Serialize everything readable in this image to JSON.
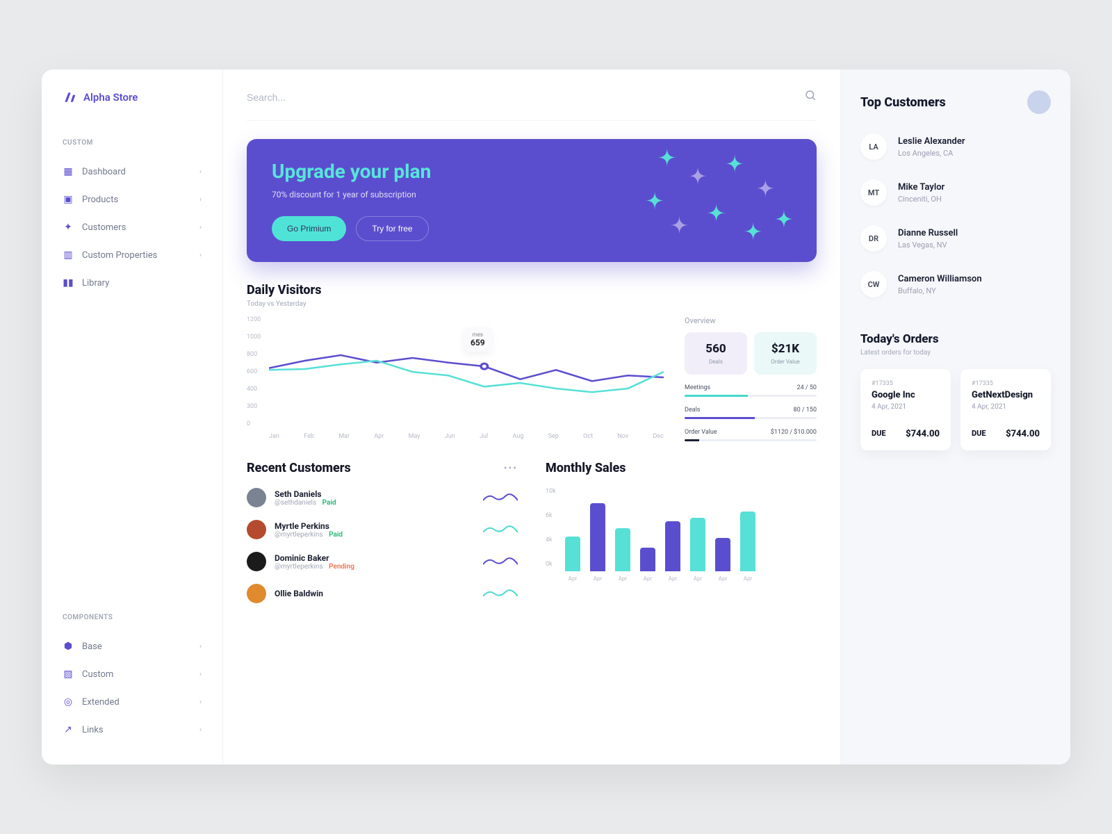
{
  "app": {
    "name": "Alpha Store"
  },
  "search": {
    "placeholder": "Search..."
  },
  "nav": {
    "custom_heading": "CUSTOM",
    "components_heading": "COMPONENTS",
    "custom": [
      {
        "label": "Dashboard",
        "chev": true
      },
      {
        "label": "Products",
        "chev": true
      },
      {
        "label": "Customers",
        "chev": true
      },
      {
        "label": "Custom Properties",
        "chev": true
      },
      {
        "label": "Library",
        "chev": false
      }
    ],
    "components": [
      {
        "label": "Base"
      },
      {
        "label": "Custom"
      },
      {
        "label": "Extended"
      },
      {
        "label": "Links"
      }
    ]
  },
  "hero": {
    "title": "Upgrade your plan",
    "subtitle": "70% discount for 1 year of subscription",
    "primary": "Go Primium",
    "secondary": "Try for free"
  },
  "visitors": {
    "title": "Daily Visitors",
    "subtitle": "Today vs Yesterday",
    "tooltip_label": "mes",
    "tooltip_value": "659",
    "overview_label": "Overview",
    "stats": [
      {
        "value": "560",
        "label": "Deals"
      },
      {
        "value": "$21K",
        "label": "Order Value"
      }
    ],
    "progress": [
      {
        "label": "Meetings",
        "value": "24 / 50",
        "pct": 48,
        "color": "#45d8cd"
      },
      {
        "label": "Deals",
        "value": "80 / 150",
        "pct": 53,
        "color": "#5b4ece"
      },
      {
        "label": "Order Value",
        "value": "$1120 / $10.000",
        "pct": 11,
        "color": "#1c2134"
      }
    ]
  },
  "recent": {
    "title": "Recent Customers",
    "rows": [
      {
        "name": "Seth Daniels",
        "handle": "@sethdaniels",
        "status": "Paid",
        "color": "#5b4ece",
        "avatar": "#7a8391"
      },
      {
        "name": "Myrtle Perkins",
        "handle": "@myrtleperkins",
        "status": "Paid",
        "color": "#4fd9cf",
        "avatar": "#b54b2e"
      },
      {
        "name": "Dominic Baker",
        "handle": "@myrtleperkins",
        "status": "Pending",
        "color": "#5b4ece",
        "avatar": "#1b1b1b"
      },
      {
        "name": "Ollie Baldwin",
        "handle": "",
        "status": "",
        "color": "#4fd9cf",
        "avatar": "#e08a2e"
      }
    ]
  },
  "monthly": {
    "title": "Monthly Sales"
  },
  "rightbar": {
    "title": "Top Customers",
    "customers": [
      {
        "initials": "LA",
        "name": "Leslie Alexander",
        "loc": "Los Angeles, CA"
      },
      {
        "initials": "MT",
        "name": "Mike Taylor",
        "loc": "Cinceniti, OH"
      },
      {
        "initials": "DR",
        "name": "Dianne Russell",
        "loc": "Las Vegas, NV"
      },
      {
        "initials": "CW",
        "name": "Cameron Williamson",
        "loc": "Buffalo, NY"
      }
    ],
    "orders_title": "Today's Orders",
    "orders_sub": "Latest orders for today",
    "orders": [
      {
        "id": "#17335",
        "name": "Google Inc",
        "date": "4 Apr, 2021",
        "due": "DUE",
        "amount": "$744.00"
      },
      {
        "id": "#17335",
        "name": "GetNextDesign",
        "date": "4 Apr, 2021",
        "due": "DUE",
        "amount": "$744.00"
      }
    ]
  },
  "chart_data": [
    {
      "type": "line",
      "title": "Daily Visitors",
      "subtitle": "Today vs Yesterday",
      "xlabel": "",
      "ylabel": "",
      "categories": [
        "Jan",
        "Feb",
        "Mar",
        "Apr",
        "May",
        "Jun",
        "Jul",
        "Aug",
        "Sep",
        "Oct",
        "Nov",
        "Dec"
      ],
      "ylim": [
        0,
        1200
      ],
      "yticks": [
        1200,
        1000,
        800,
        600,
        400,
        300,
        0
      ],
      "series": [
        {
          "name": "Today",
          "color": "#5b4ece",
          "values": [
            640,
            720,
            780,
            700,
            750,
            700,
            659,
            520,
            620,
            500,
            560,
            540
          ]
        },
        {
          "name": "Yesterday",
          "color": "#57e0d6",
          "values": [
            620,
            630,
            680,
            720,
            600,
            560,
            440,
            480,
            420,
            380,
            420,
            600
          ]
        }
      ],
      "tooltip": {
        "x": "Jul",
        "value": 659
      }
    },
    {
      "type": "bar",
      "title": "Monthly Sales",
      "xlabel": "",
      "ylabel": "",
      "categories": [
        "Apr",
        "Apr",
        "Apr",
        "Apr",
        "Apr",
        "Apr",
        "Apr",
        "Apr"
      ],
      "ylim": [
        0,
        10000
      ],
      "yticks_labels": [
        "10k",
        "6k",
        "4k",
        "0k"
      ],
      "values": [
        4200,
        8200,
        5200,
        2800,
        6000,
        6400,
        4000,
        7200
      ],
      "colors": [
        "#57e0d6",
        "#5b4ece",
        "#57e0d6",
        "#5b4ece",
        "#5b4ece",
        "#57e0d6",
        "#5b4ece",
        "#57e0d6"
      ]
    }
  ]
}
